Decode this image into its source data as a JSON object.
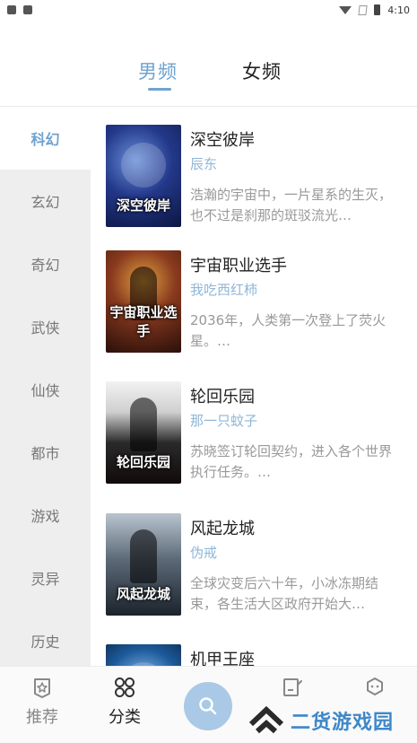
{
  "status_bar": {
    "time": "4:10"
  },
  "top_tabs": [
    {
      "label": "男频",
      "active": true
    },
    {
      "label": "女频",
      "active": false
    }
  ],
  "categories": [
    {
      "label": "科幻",
      "active": true
    },
    {
      "label": "玄幻",
      "active": false
    },
    {
      "label": "奇幻",
      "active": false
    },
    {
      "label": "武侠",
      "active": false
    },
    {
      "label": "仙侠",
      "active": false
    },
    {
      "label": "都市",
      "active": false
    },
    {
      "label": "游戏",
      "active": false
    },
    {
      "label": "灵异",
      "active": false
    },
    {
      "label": "历史",
      "active": false
    }
  ],
  "books": [
    {
      "title": "深空彼岸",
      "author": "辰东",
      "description": "浩瀚的宇宙中，一片星系的生灭，也不过是刹那的斑驳流光…",
      "cover_text": "深空彼岸"
    },
    {
      "title": "宇宙职业选手",
      "author": "我吃西红柿",
      "description": "2036年，人类第一次登上了荧火星。…",
      "cover_text": "宇宙职业选手"
    },
    {
      "title": "轮回乐园",
      "author": "那一只蚊子",
      "description": "苏晓签订轮回契约，进入各个世界执行任务。…",
      "cover_text": "轮回乐园"
    },
    {
      "title": "风起龙城",
      "author": "伪戒",
      "description": "全球灾变后六十年，小冰冻期结束，各生活大区政府开始大…",
      "cover_text": "风起龙城"
    },
    {
      "title": "机甲王座",
      "author": "",
      "description": "",
      "cover_text": ""
    }
  ],
  "bottom_nav": {
    "recommend": "推荐",
    "category": "分类",
    "search_icon": "search-icon",
    "shelf_icon": "bookshelf-icon",
    "mine_icon": "profile-icon"
  },
  "watermark": {
    "text": "二货游戏园"
  },
  "colors": {
    "accent": "#6fa3cf",
    "author": "#8fb6d8",
    "sidebar_bg": "#eeeeee",
    "fab": "#a9c9e6",
    "watermark": "#3e87c8"
  }
}
